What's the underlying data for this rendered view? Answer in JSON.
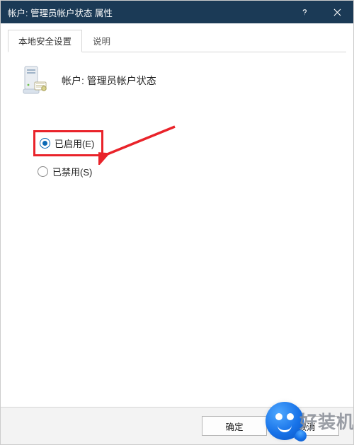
{
  "titlebar": {
    "title": "帐户: 管理员帐户状态 属性"
  },
  "tabs": {
    "local_security": "本地安全设置",
    "explain": "说明"
  },
  "header": {
    "label": "帐户: 管理员帐户状态"
  },
  "radios": {
    "enabled": "已启用(E)",
    "disabled": "已禁用(S)"
  },
  "footer": {
    "ok": "确定",
    "cancel": "取消"
  },
  "watermark": {
    "text": "好装机"
  }
}
